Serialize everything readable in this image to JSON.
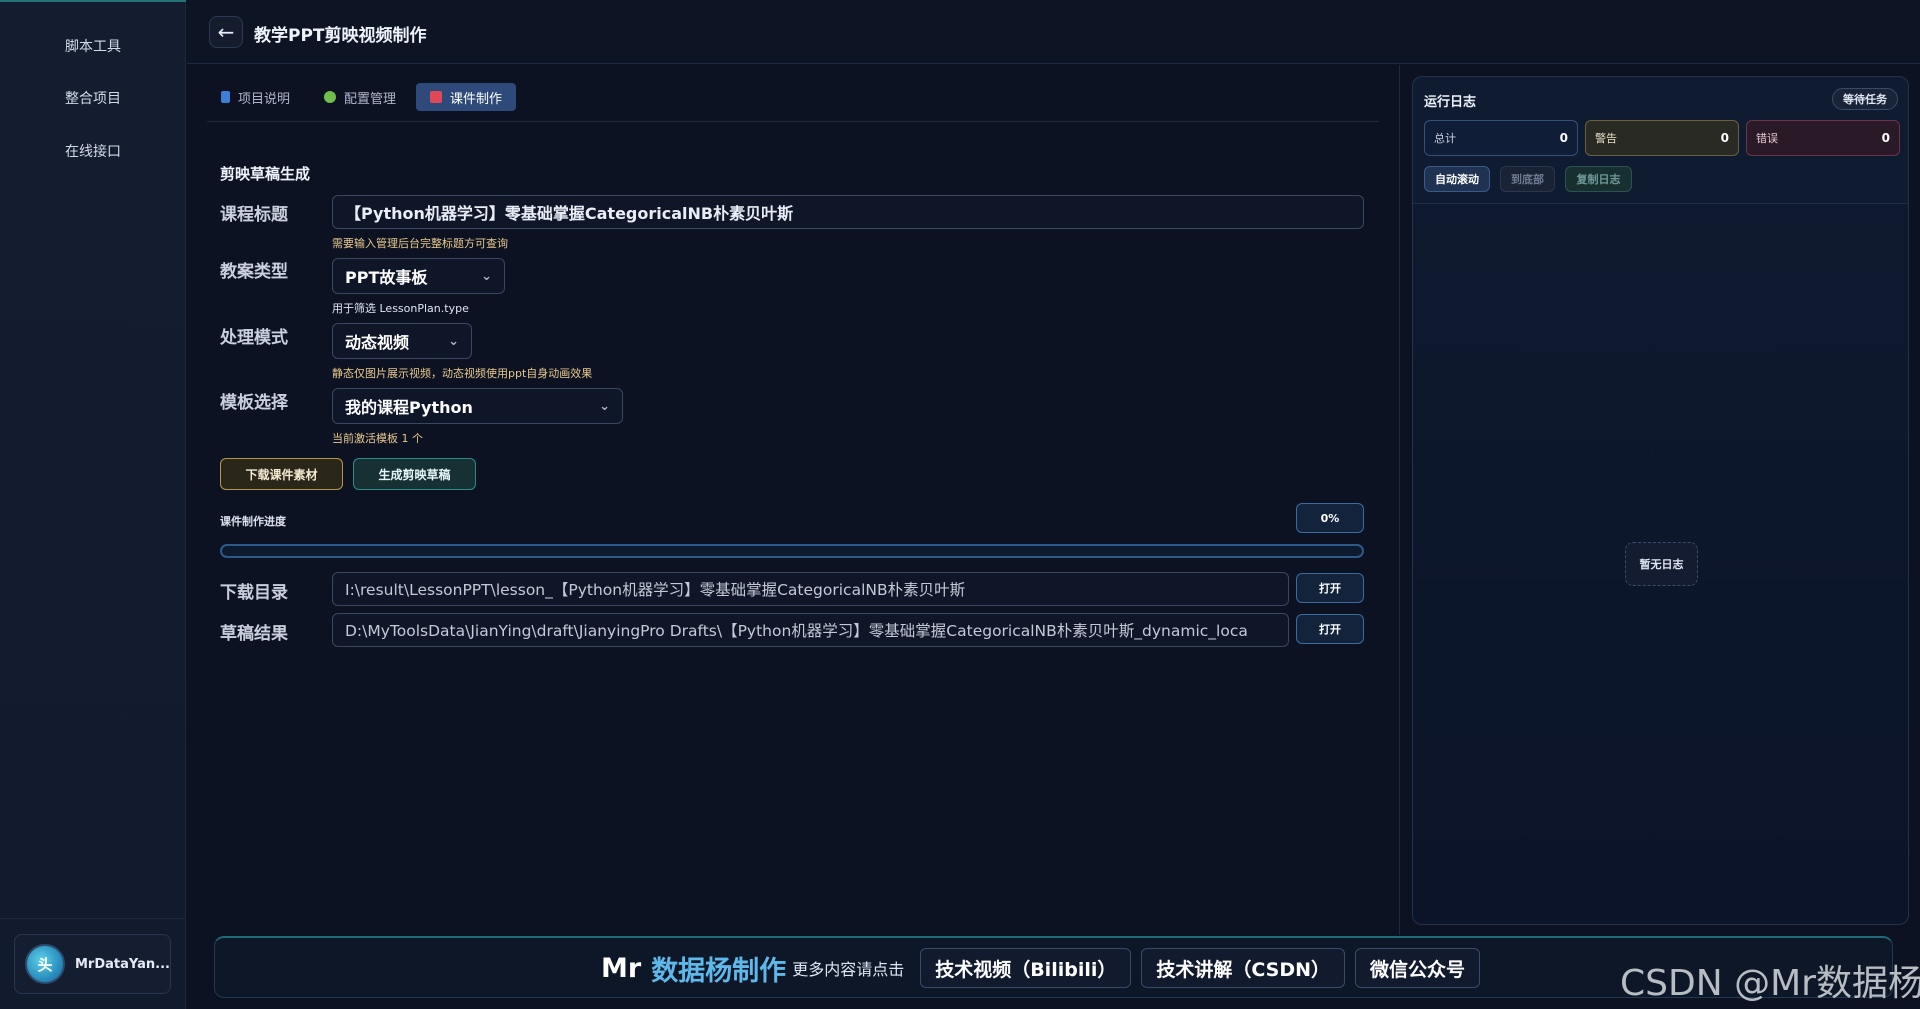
{
  "sidebar": {
    "items": [
      {
        "label": "脚本工具"
      },
      {
        "label": "整合项目"
      },
      {
        "label": "在线接口"
      }
    ],
    "user": {
      "avatar_text": "头",
      "name": "MrDataYan..."
    }
  },
  "header": {
    "back_icon": "←",
    "title": "教学PPT剪映视频制作"
  },
  "tabs": [
    {
      "label": "项目说明"
    },
    {
      "label": "配置管理"
    },
    {
      "label": "课件制作"
    }
  ],
  "form": {
    "section_title": "剪映草稿生成",
    "course_title": {
      "label": "课程标题",
      "value": "【Python机器学习】零基础掌握CategoricalNB朴素贝叶斯",
      "hint": "需要输入管理后台完整标题方可查询"
    },
    "lesson_type": {
      "label": "教案类型",
      "value": "PPT故事板",
      "hint": "用于筛选 LessonPlan.type"
    },
    "mode": {
      "label": "处理模式",
      "value": "动态视频",
      "hint": "静态仅图片展示视频，动态视频使用ppt自身动画效果"
    },
    "template": {
      "label": "模板选择",
      "value": "我的课程Python",
      "hint": "当前激活模板 1 个"
    },
    "download_button": "下载课件素材",
    "generate_button": "生成剪映草稿",
    "progress_label": "课件制作进度",
    "progress_text": "0%",
    "progress_value": 0.0,
    "download_dir": {
      "label": "下载目录",
      "value": "I:\\result\\LessonPPT\\lesson_【Python机器学习】零基础掌握CategoricalNB朴素贝叶斯",
      "button": "打开"
    },
    "draft_result": {
      "label": "草稿结果",
      "value": "D:\\MyToolsData\\JianYing\\draft\\JianyingPro Drafts\\【Python机器学习】零基础掌握CategoricalNB朴素贝叶斯_dynamic_loca",
      "button": "打开"
    }
  },
  "log": {
    "title": "运行日志",
    "status": "等待任务",
    "stats": [
      {
        "label": "总计",
        "value": "0"
      },
      {
        "label": "警告",
        "value": "0"
      },
      {
        "label": "错误",
        "value": "0"
      }
    ],
    "buttons": {
      "auto_scroll": "自动滚动",
      "to_bottom": "到底部",
      "copy": "复制日志"
    },
    "empty": "暂无日志"
  },
  "footer": {
    "brand_prefix": "Mr",
    "brand_name": "数据杨制作",
    "more": "更多内容请点击",
    "links": [
      {
        "label": "技术视频（Bilibili）"
      },
      {
        "label": "技术讲解（CSDN）"
      },
      {
        "label": "微信公众号"
      }
    ]
  },
  "watermark": "CSDN @Mr数据杨",
  "colors": {
    "accent": "#2e4a7a",
    "brand": "#5fb8ea",
    "warn_text": "#e8c98e"
  }
}
